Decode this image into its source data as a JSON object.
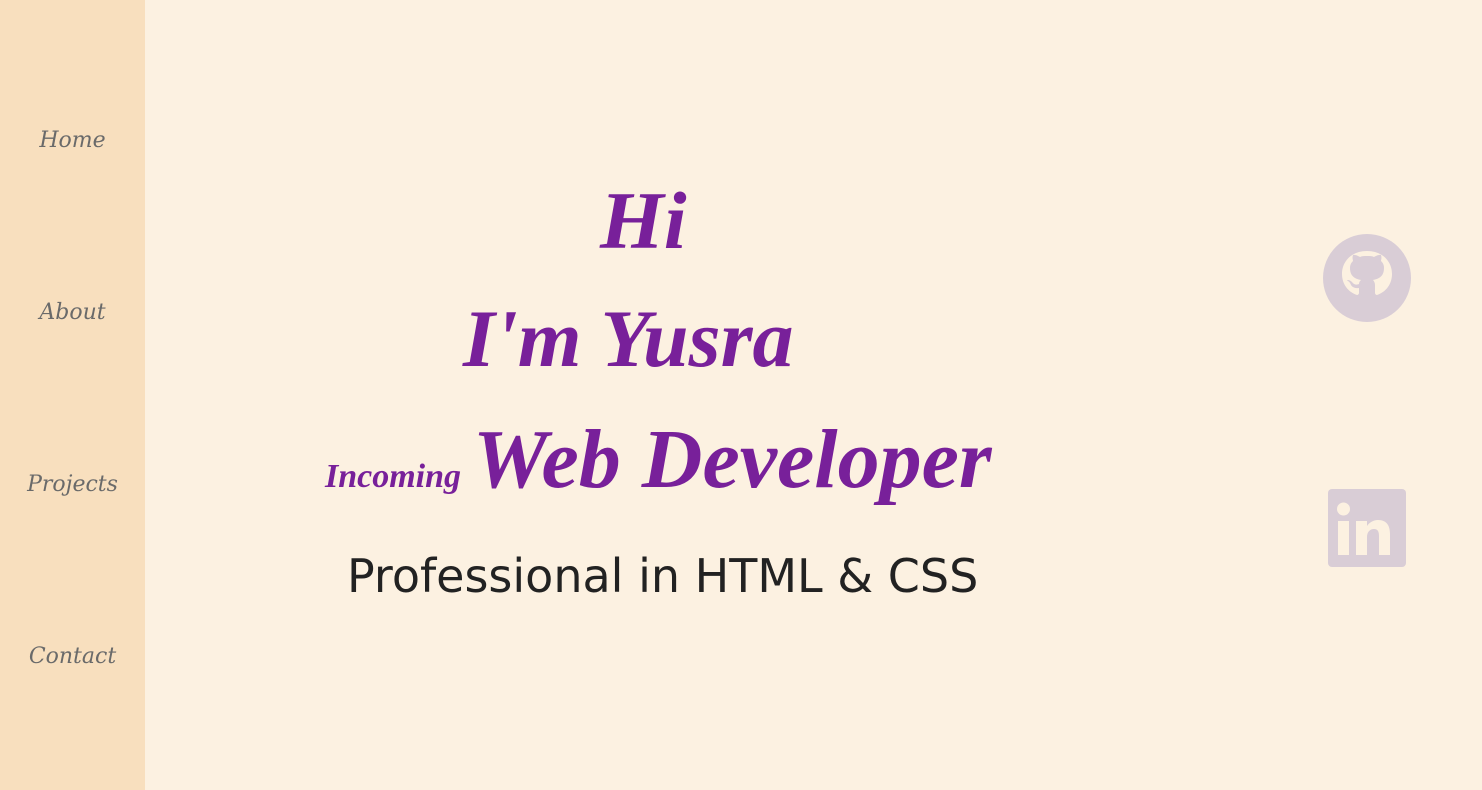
{
  "nav": {
    "items": [
      {
        "label": "Home"
      },
      {
        "label": "About"
      },
      {
        "label": "Projects"
      },
      {
        "label": "Contact"
      }
    ]
  },
  "hero": {
    "greeting": "Hi",
    "name_line": "I'm Yusra",
    "role_prefix": "Incoming",
    "role": "Web Developer",
    "tagline": "Professional in HTML & CSS"
  },
  "social": {
    "icons": [
      "github-icon",
      "linkedin-icon"
    ]
  },
  "colors": {
    "sidebar_bg": "#f8dfbe",
    "page_bg": "#fcf1e1",
    "accent_purple": "#78209a",
    "nav_text": "#6a6a6a",
    "icon_gray": "#d9cdd6"
  }
}
